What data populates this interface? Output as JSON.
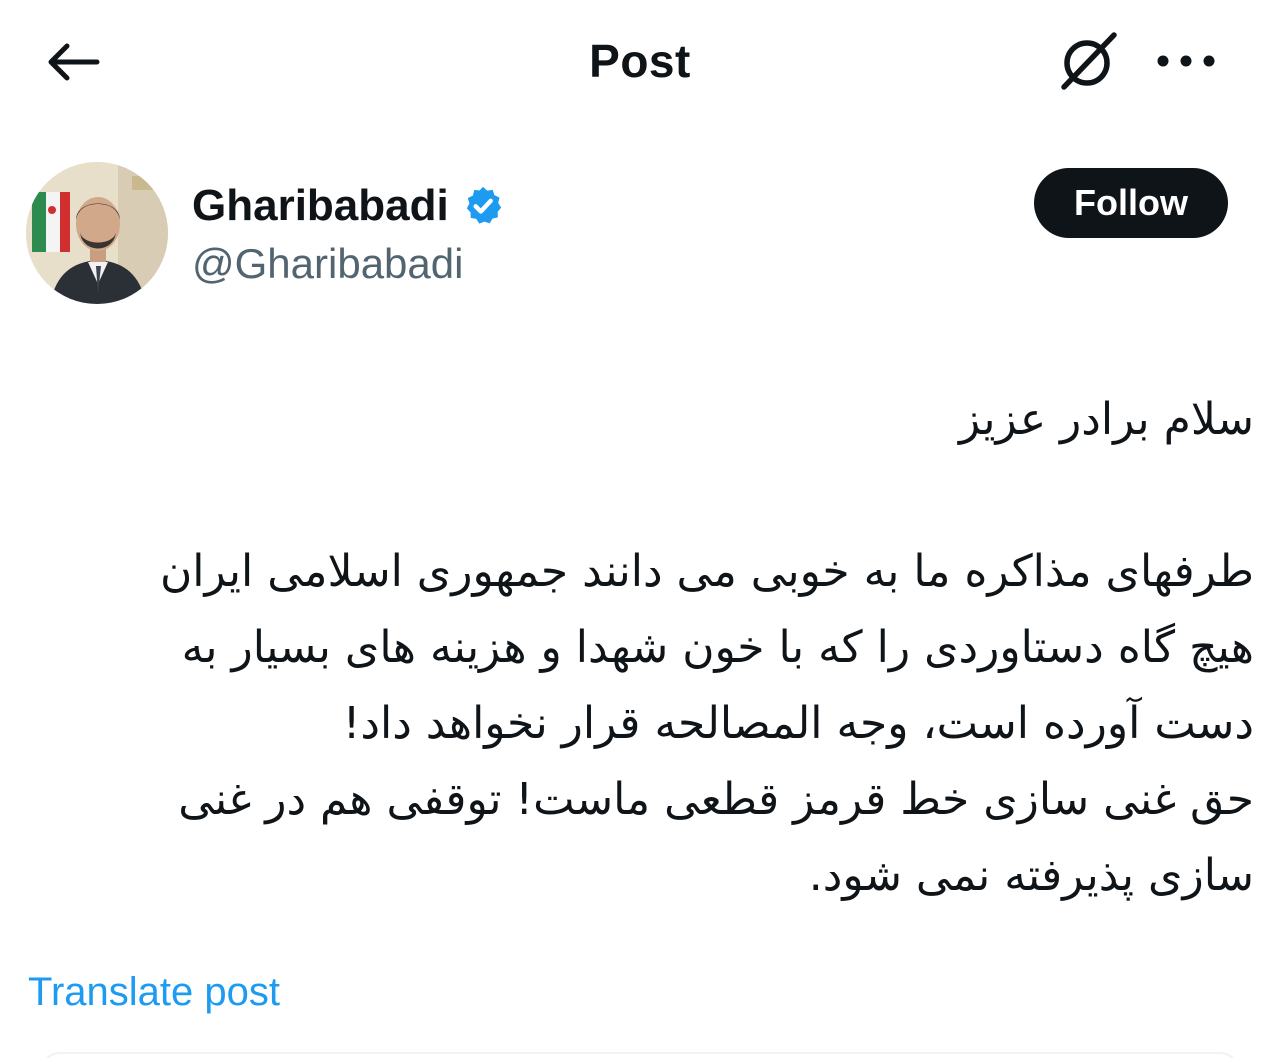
{
  "header": {
    "title": "Post",
    "back_icon": "arrow-left-icon",
    "grok_icon": "grok-slash-circle-icon",
    "more_icon": "more-horizontal-icon"
  },
  "author": {
    "name": "Gharibabadi",
    "handle": "@Gharibabadi",
    "verified": true,
    "verified_color": "#1d9bf0",
    "follow_label": "Follow"
  },
  "post": {
    "greeting": "سلام برادر عزیز",
    "lines": [
      "طرفهای مذاکره ما به خوبی می دانند جمهوری اسلامی ایران",
      "هیچ گاه دستاوردی را که با خون شهدا و هزینه های بسیار به",
      "دست آورده است، وجه المصالحه قرار نخواهد داد!",
      "حق غنی سازی خط قرمز قطعی ماست! توقفی هم در غنی",
      "سازی پذیرفته نمی شود."
    ]
  },
  "translate_label": "Translate post",
  "colors": {
    "text_primary": "#0f1419",
    "text_secondary": "#536471",
    "link": "#1d9bf0",
    "follow_bg": "#0f1419"
  }
}
